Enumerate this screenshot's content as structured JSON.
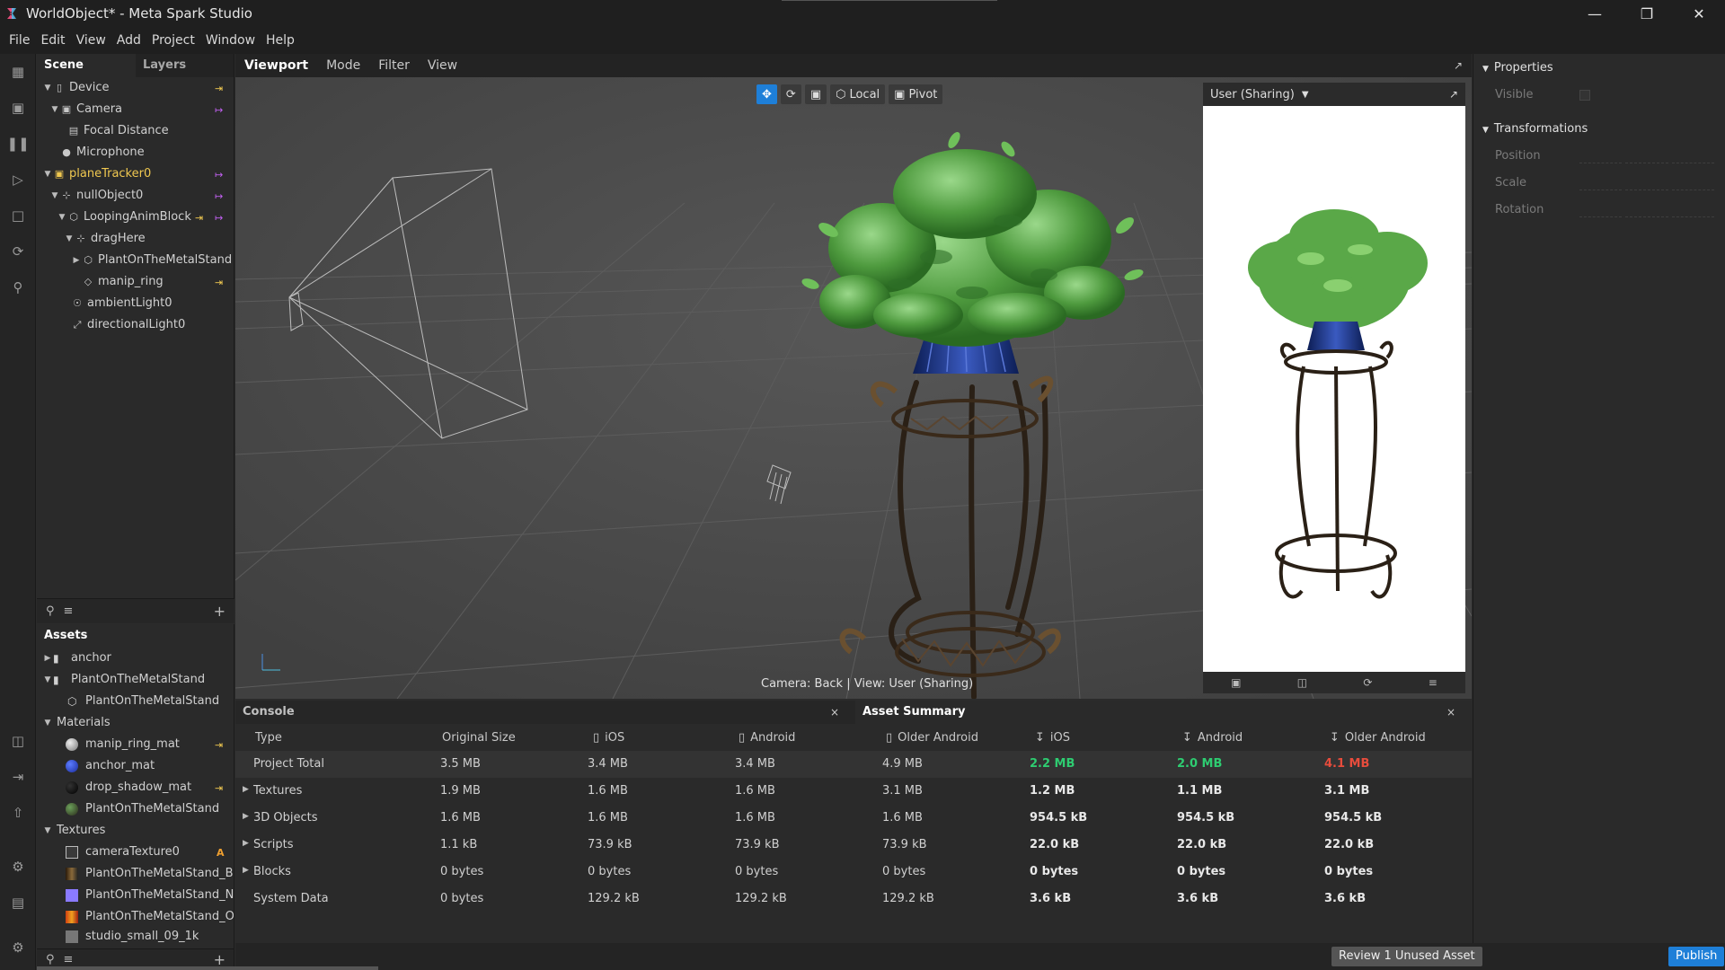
{
  "app": {
    "window_title": "WorldObject* - Meta Spark Studio"
  },
  "menu": [
    "File",
    "Edit",
    "View",
    "Add",
    "Project",
    "Window",
    "Help"
  ],
  "scene": {
    "tabs": {
      "scene": "Scene",
      "layers": "Layers"
    },
    "tree": [
      {
        "label": "Device"
      },
      {
        "label": "Camera"
      },
      {
        "label": "Focal Distance"
      },
      {
        "label": "Microphone"
      },
      {
        "label": "planeTracker0"
      },
      {
        "label": "nullObject0"
      },
      {
        "label": "LoopingAnimBlock"
      },
      {
        "label": "dragHere"
      },
      {
        "label": "PlantOnTheMetalStand"
      },
      {
        "label": "manip_ring"
      },
      {
        "label": "ambientLight0"
      },
      {
        "label": "directionalLight0"
      }
    ]
  },
  "assets": {
    "title": "Assets",
    "items": [
      {
        "label": "anchor"
      },
      {
        "label": "PlantOnTheMetalStand"
      },
      {
        "label": "PlantOnTheMetalStand"
      },
      {
        "label": "Materials"
      },
      {
        "label": "manip_ring_mat"
      },
      {
        "label": "anchor_mat"
      },
      {
        "label": "drop_shadow_mat"
      },
      {
        "label": "PlantOnTheMetalStand"
      },
      {
        "label": "Textures"
      },
      {
        "label": "cameraTexture0",
        "badge": "A"
      },
      {
        "label": "PlantOnTheMetalStand_Ba..."
      },
      {
        "label": "PlantOnTheMetalStand_N..."
      },
      {
        "label": "PlantOnTheMetalStand_O..."
      },
      {
        "label": "studio_small_09_1k"
      }
    ]
  },
  "viewport": {
    "tabs": [
      "Viewport",
      "Mode",
      "Filter",
      "View"
    ],
    "toolbar": {
      "local": "Local",
      "pivot": "Pivot"
    },
    "camera_label": "Camera: Back | View: User (Sharing)"
  },
  "preview": {
    "device": "User (Sharing)"
  },
  "properties": {
    "title": "Properties",
    "visible": "Visible",
    "transformations": "Transformations",
    "position": "Position",
    "scale": "Scale",
    "rotation": "Rotation"
  },
  "bottom": {
    "console_tab": "Console",
    "summary_tab": "Asset Summary",
    "close": "×",
    "columns": [
      "Type",
      "Original Size",
      "iOS",
      "Android",
      "Older Android",
      "iOS",
      "Android",
      "Older Android"
    ],
    "rows": [
      {
        "type": "Project Total",
        "cells": [
          "3.5 MB",
          "3.4 MB",
          "3.4 MB",
          "4.9 MB",
          "2.2 MB",
          "2.0 MB",
          "4.1 MB"
        ]
      },
      {
        "type": "Textures",
        "cells": [
          "1.9 MB",
          "1.6 MB",
          "1.6 MB",
          "3.1 MB",
          "1.2 MB",
          "1.1 MB",
          "3.1 MB"
        ]
      },
      {
        "type": "3D Objects",
        "cells": [
          "1.6 MB",
          "1.6 MB",
          "1.6 MB",
          "1.6 MB",
          "954.5 kB",
          "954.5 kB",
          "954.5 kB"
        ]
      },
      {
        "type": "Scripts",
        "cells": [
          "1.1 kB",
          "73.9 kB",
          "73.9 kB",
          "73.9 kB",
          "22.0 kB",
          "22.0 kB",
          "22.0 kB"
        ]
      },
      {
        "type": "Blocks",
        "cells": [
          "0 bytes",
          "0 bytes",
          "0 bytes",
          "0 bytes",
          "0 bytes",
          "0 bytes",
          "0 bytes"
        ]
      },
      {
        "type": "System Data",
        "cells": [
          "0 bytes",
          "129.2 kB",
          "129.2 kB",
          "129.2 kB",
          "3.6 kB",
          "3.6 kB",
          "3.6 kB"
        ]
      }
    ]
  },
  "status": {
    "review": "Review 1 Unused Asset",
    "publish": "Publish"
  },
  "colors": {
    "accent": "#1e7fd8",
    "green": "#2ecc71",
    "red": "#e74c3c",
    "yellow": "#f0c850",
    "link": "#c060f0"
  }
}
